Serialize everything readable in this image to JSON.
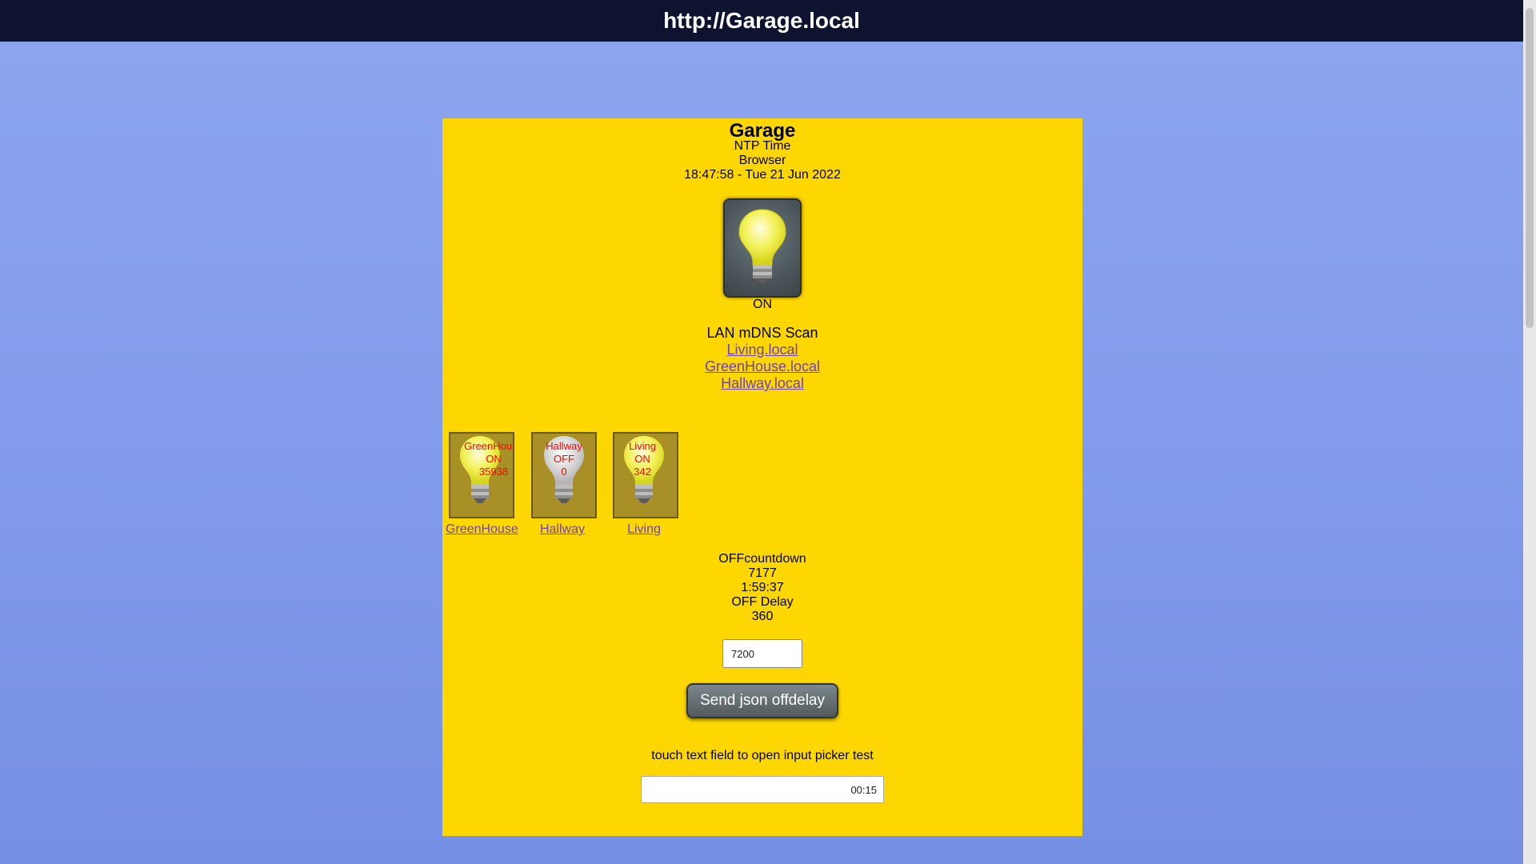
{
  "header": {
    "url_title": "http://Garage.local"
  },
  "device": {
    "name": "Garage",
    "time_source": "NTP Time",
    "time_client": "Browser",
    "datetime": "18:47:58 - Tue 21 Jun 2022"
  },
  "main_switch": {
    "state": "ON",
    "bulb_icon": "bulb-on-icon"
  },
  "scan": {
    "title": "LAN mDNS Scan",
    "links": [
      "Living.local",
      "GreenHouse.local",
      "Hallway.local"
    ]
  },
  "nodes": [
    {
      "name": "GreenHouse",
      "state": "ON",
      "value": "35938",
      "link": "GreenHouse",
      "lit": true
    },
    {
      "name": "Hallway",
      "state": "OFF",
      "value": "0",
      "link": "Hallway",
      "lit": false
    },
    {
      "name": "Living",
      "state": "ON",
      "value": "342",
      "link": "Living",
      "lit": true
    }
  ],
  "countdown": {
    "label": "OFFcountdown",
    "seconds": "7177",
    "hms": "1:59:37",
    "delay_label": "OFF Delay",
    "delay_value": "360"
  },
  "delay_input": {
    "value": "7200"
  },
  "send_button": {
    "label": "Send json offdelay"
  },
  "picker": {
    "label": "touch text field to open input picker test",
    "value": "00:15"
  },
  "colors": {
    "panel": "#ffd700",
    "topbar": "#0e1330",
    "link": "#6e43b3",
    "node_text": "#ff0000"
  }
}
